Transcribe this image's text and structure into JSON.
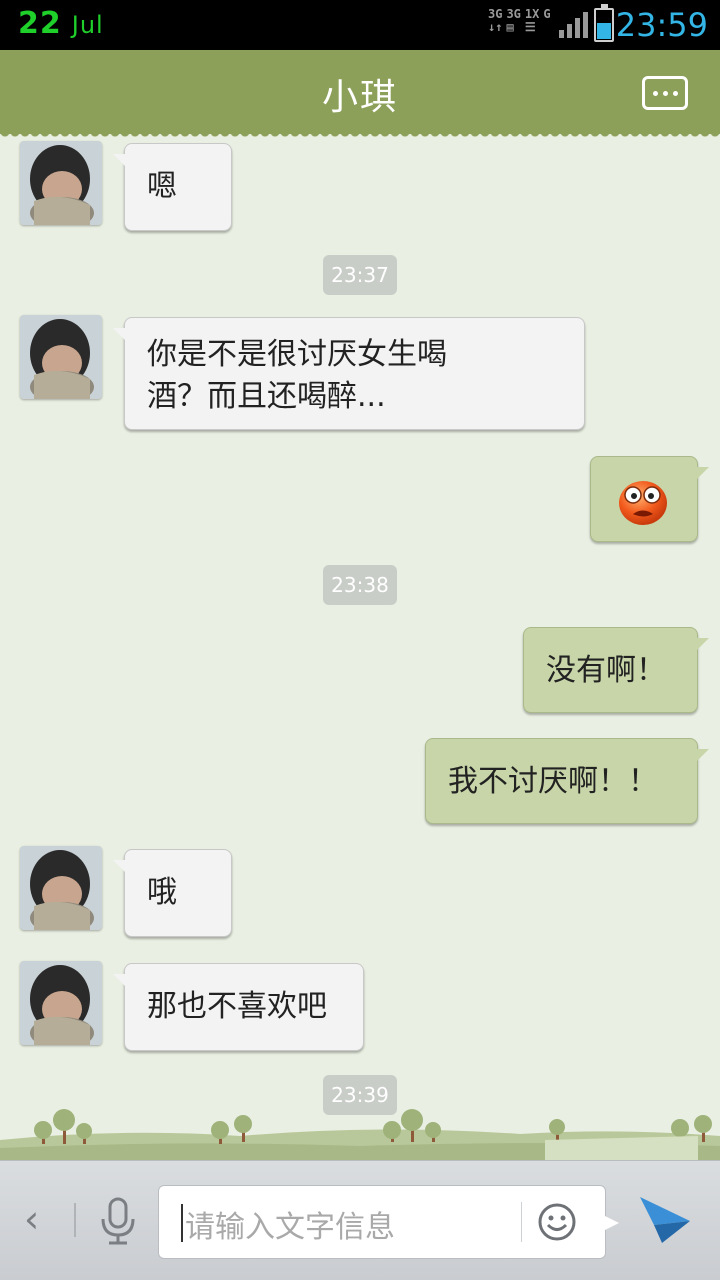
{
  "status_bar": {
    "date_day": "22",
    "date_month": "Jul",
    "net_1": "3G",
    "net_2": "3G",
    "net_3": "1X",
    "net_4": "G",
    "time": "23:59",
    "battery_level": 0.55,
    "signal_bars": 4
  },
  "header": {
    "title": "小琪",
    "menu_icon": "chat-menu-icon"
  },
  "messages": [
    {
      "side": "left",
      "text": "嗯"
    },
    {
      "type": "time",
      "text": "23:37"
    },
    {
      "side": "left",
      "text": "你是不是很讨厌女生喝酒？而且还喝醉..."
    },
    {
      "side": "right",
      "type": "emoji",
      "icon": "shocked-face-emoji"
    },
    {
      "type": "time",
      "text": "23:38"
    },
    {
      "side": "right",
      "text": "没有啊！"
    },
    {
      "side": "right",
      "text": "我不讨厌啊！！"
    },
    {
      "side": "left",
      "text": "哦"
    },
    {
      "side": "left",
      "text": "那也不喜欢吧"
    },
    {
      "type": "time",
      "text": "23:39"
    }
  ],
  "input_bar": {
    "back_icon": "chevron-left-icon",
    "voice_icon": "microphone-icon",
    "placeholder": "请输入文字信息",
    "emoji_icon": "smiley-icon",
    "send_icon": "send-icon"
  },
  "colors": {
    "header": "#8ca05a",
    "background": "#e9efe2",
    "bubble_self": "#c7d5a8",
    "bubble_other": "#f3f3f3",
    "status_date": "#1fcf2a",
    "status_time": "#33b5e5"
  }
}
